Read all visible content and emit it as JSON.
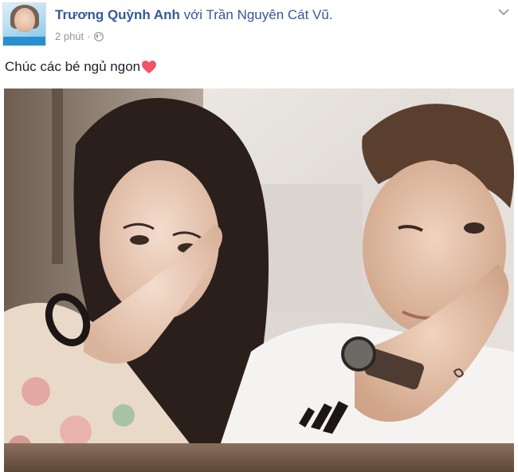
{
  "post": {
    "author": "Trương Quỳnh Anh",
    "with_word": "với",
    "tagged": "Trần Nguyên Cát Vũ.",
    "time": "2 phút",
    "separator": "·",
    "privacy_icon": "globe-icon",
    "menu_icon": "chevron-down-icon",
    "caption": "Chúc các bé ngủ ngon",
    "caption_emoji": "heart-icon"
  },
  "colors": {
    "link": "#365899",
    "meta": "#90949c",
    "heart": "#f25268"
  }
}
